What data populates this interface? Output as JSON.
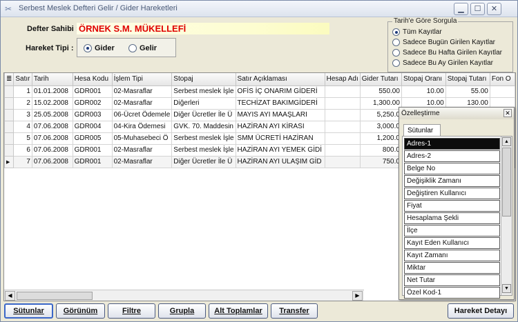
{
  "window": {
    "title": "Serbest Meslek Defteri Gelir / Gider Hareketleri",
    "controls": [
      "minimize",
      "maximize",
      "close"
    ]
  },
  "header": {
    "owner_label": "Defter Sahibi :",
    "owner_value": "ÖRNEK S.M. MÜKELLEFİ",
    "type_label": "Hareket Tipi :",
    "type_options": [
      {
        "label": "Gider",
        "checked": true
      },
      {
        "label": "Gelir",
        "checked": false
      }
    ]
  },
  "date_filter": {
    "legend": "Tarih'e Göre Sorgula",
    "options": [
      {
        "label": "Tüm Kayıtlar",
        "checked": true
      },
      {
        "label": "Sadece Bugün Girilen Kayıtlar",
        "checked": false
      },
      {
        "label": "Sadece Bu Hafta Girilen Kayıtlar",
        "checked": false
      },
      {
        "label": "Sadece Bu Ay Girilen Kayıtlar",
        "checked": false
      }
    ]
  },
  "grid": {
    "columns": [
      "Satır",
      "Tarih",
      "Hesa Kodu",
      "İşlem Tipi",
      "Stopaj",
      "Satır Açıklaması",
      "Hesap Adı",
      "Gider Tutarı",
      "Stopaj Oranı",
      "Stopaj Tutarı",
      "Fon O"
    ],
    "rows": [
      {
        "satir": "1",
        "tarih": "01.01.2008",
        "kod": "GDR001",
        "islem": "02-Masraflar",
        "stopaj": "Serbest meslek İşle",
        "aciklama": "OFİS İÇ ONARIM GİDERİ",
        "hesap": "",
        "gider": "550.00",
        "oran": "10.00",
        "stutar": "55.00",
        "fon": "",
        "current": false
      },
      {
        "satir": "2",
        "tarih": "15.02.2008",
        "kod": "GDR002",
        "islem": "02-Masraflar",
        "stopaj": "Diğerleri",
        "aciklama": "TECHİZAT BAKIMGİDERİ",
        "hesap": "",
        "gider": "1,300.00",
        "oran": "10.00",
        "stutar": "130.00",
        "fon": "",
        "current": false
      },
      {
        "satir": "3",
        "tarih": "25.05.2008",
        "kod": "GDR003",
        "islem": "06-Ücret Ödemele",
        "stopaj": "Diğer Ücretler İle Ü",
        "aciklama": "MAYIS AYI MAAŞLARI",
        "hesap": "",
        "gider": "5,250.0",
        "oran": "",
        "stutar": "",
        "fon": "",
        "current": false
      },
      {
        "satir": "4",
        "tarih": "07.06.2008",
        "kod": "GDR004",
        "islem": "04-Kira Ödemesi",
        "stopaj": "GVK. 70. Maddesin",
        "aciklama": "HAZİRAN AYI KİRASI",
        "hesap": "",
        "gider": "3,000.0",
        "oran": "",
        "stutar": "",
        "fon": "",
        "current": false
      },
      {
        "satir": "5",
        "tarih": "07.06.2008",
        "kod": "GDR005",
        "islem": "05-Muhasebeci Ö",
        "stopaj": "Serbest meslek İşle",
        "aciklama": "SMM ÜCRETİ HAZİRAN",
        "hesap": "",
        "gider": "1,200.0",
        "oran": "",
        "stutar": "",
        "fon": "",
        "current": false
      },
      {
        "satir": "6",
        "tarih": "07.06.2008",
        "kod": "GDR001",
        "islem": "02-Masraflar",
        "stopaj": "Serbest meslek İşle",
        "aciklama": "HAZİRAN AYI YEMEK GİDİ",
        "hesap": "",
        "gider": "800.0",
        "oran": "",
        "stutar": "",
        "fon": "",
        "current": false
      },
      {
        "satir": "7",
        "tarih": "07.06.2008",
        "kod": "GDR001",
        "islem": "02-Masraflar",
        "stopaj": "Diğer Ücretler İle Ü",
        "aciklama": "HAZİRAN AYI ULAŞIM GİD",
        "hesap": "",
        "gider": "750.0",
        "oran": "",
        "stutar": "",
        "fon": "",
        "current": true
      }
    ]
  },
  "customize": {
    "title": "Özelleştirme",
    "tab": "Sütunlar",
    "items": [
      "Adres-1",
      "Adres-2",
      "Belge No",
      "Değişiklik Zamanı",
      "Değiştiren Kullanıcı",
      "Fiyat",
      "Hesaplama Şekli",
      "İlçe",
      "Kayıt Eden Kullanıcı",
      "Kayıt Zamanı",
      "Miktar",
      "Net Tutar",
      "Özel Kod-1"
    ],
    "selected": "Adres-1"
  },
  "toolbar": {
    "buttons": [
      "Sütunlar",
      "Görünüm",
      "Filtre",
      "Grupla",
      "Alt Toplamlar",
      "Transfer"
    ],
    "detail_button": "Hareket Detayı"
  }
}
